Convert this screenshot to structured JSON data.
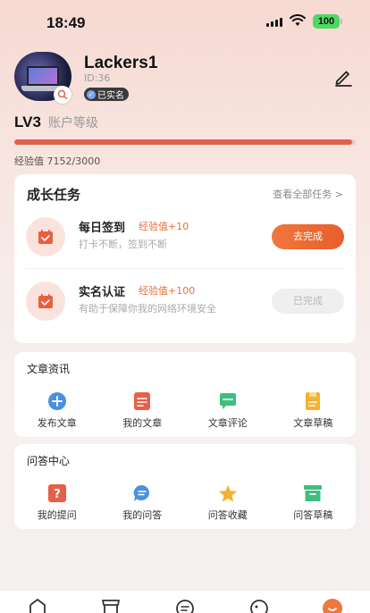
{
  "status_bar": {
    "time": "18:49",
    "battery": "100"
  },
  "profile": {
    "username": "Lackers1",
    "user_id": "ID:36",
    "verified": "已实名"
  },
  "level": {
    "label": "LV3",
    "desc": "账户等级",
    "progress_fraction": 0.99,
    "exp_text": "经验值 7152/3000"
  },
  "tasks": {
    "title": "成长任务",
    "see_all": "查看全部任务 >",
    "items": [
      {
        "name": "每日签到",
        "exp": "经验值+10",
        "desc": "打卡不断，签到不断",
        "button": "去完成"
      },
      {
        "name": "实名认证",
        "exp": "经验值+100",
        "desc": "有助于保障你我的网络环境安全",
        "button": "已完成"
      }
    ]
  },
  "articles": {
    "title": "文章资讯",
    "items": [
      {
        "label": "发布文章",
        "icon": "plus-circle-icon"
      },
      {
        "label": "我的文章",
        "icon": "document-icon"
      },
      {
        "label": "文章评论",
        "icon": "comment-icon"
      },
      {
        "label": "文章草稿",
        "icon": "draft-icon"
      }
    ]
  },
  "qa": {
    "title": "问答中心",
    "items": [
      {
        "label": "我的提问",
        "icon": "question-icon"
      },
      {
        "label": "我的问答",
        "icon": "chat-bubble-icon"
      },
      {
        "label": "问答收藏",
        "icon": "star-icon"
      },
      {
        "label": "问答草稿",
        "icon": "archive-icon"
      }
    ]
  },
  "colors": {
    "accent": "#e95e2a",
    "progress": "#e0614a",
    "exp_text": "#e4733a",
    "blue": "#4a90e2",
    "red_icon": "#e5604a",
    "green_icon": "#3fbf7f",
    "yellow_icon": "#f2b233"
  },
  "tab_bar": {
    "icons": [
      "home-icon",
      "shop-icon",
      "message-icon",
      "discover-icon",
      "profile-icon"
    ]
  }
}
